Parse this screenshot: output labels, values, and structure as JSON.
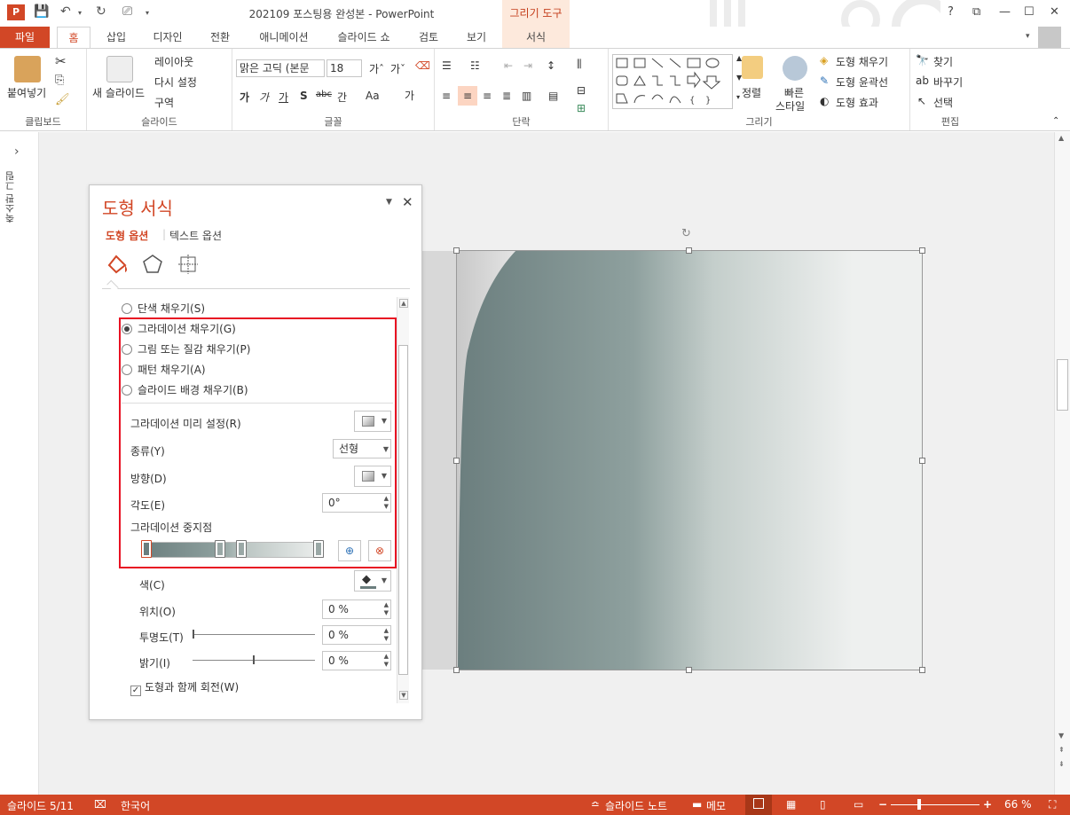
{
  "app": {
    "logo": "P",
    "doc_title": "202109 포스팅용 완성본 - PowerPoint",
    "context_group": "그리기 도구",
    "window_buttons": {
      "help": "?",
      "ribbon_options": "⧉",
      "minimize": "—",
      "maximize": "☐",
      "close": "✕"
    }
  },
  "tabs": [
    {
      "label": "파일"
    },
    {
      "label": "홈"
    },
    {
      "label": "삽입"
    },
    {
      "label": "디자인"
    },
    {
      "label": "전환"
    },
    {
      "label": "애니메이션"
    },
    {
      "label": "슬라이드 쇼"
    },
    {
      "label": "검토"
    },
    {
      "label": "보기"
    },
    {
      "label": "서식"
    }
  ],
  "ribbon": {
    "clipboard": {
      "paste": "붙여넣기",
      "group": "클립보드"
    },
    "slides": {
      "new_slide": "새 슬라이드",
      "layout": "레이아웃",
      "reset": "다시 설정",
      "section": "구역",
      "group": "슬라이드"
    },
    "font": {
      "name": "맑은 고딕 (본문",
      "size": "18",
      "group": "글꼴",
      "bold": "가",
      "italic": "가",
      "underline": "가",
      "shadow": "S",
      "strike": "abc",
      "spacing": "간",
      "case": "Aa",
      "color": "가"
    },
    "paragraph": {
      "group": "단락"
    },
    "drawing": {
      "arrange": "정렬",
      "quick_styles": "빠른",
      "quick_styles2": "스타일",
      "fill": "도형 채우기",
      "outline": "도형 윤곽선",
      "effects": "도형 효과",
      "group": "그리기"
    },
    "editing": {
      "find": "찾기",
      "replace": "바꾸기",
      "select": "선택",
      "group": "편집"
    }
  },
  "left_strip": {
    "label": "축소판 그림",
    "expand": "›"
  },
  "pane": {
    "title": "도형 서식",
    "tab_shape": "도형 옵션",
    "tab_text": "텍스트 옵션",
    "fill_options": [
      {
        "label": "단색 채우기(S)",
        "selected": false
      },
      {
        "label": "그라데이션 채우기(G)",
        "selected": true
      },
      {
        "label": "그림 또는 질감 채우기(P)",
        "selected": false
      },
      {
        "label": "패턴 채우기(A)",
        "selected": false
      },
      {
        "label": "슬라이드 배경 채우기(B)",
        "selected": false
      }
    ],
    "preset_label": "그라데이션 미리 설정(R)",
    "type_label": "종류(Y)",
    "type_value": "선형",
    "direction_label": "방향(D)",
    "angle_label": "각도(E)",
    "angle_value": "0°",
    "stops_label": "그라데이션 중지점",
    "stops": [
      0.0,
      0.43,
      0.55,
      1.0
    ],
    "color_label": "색(C)",
    "position_label": "위치(O)",
    "position_value": "0 %",
    "transparency_label": "투명도(T)",
    "transparency_value": "0 %",
    "brightness_label": "밝기(I)",
    "brightness_value": "0 %",
    "rotate_label": "도형과 함께 회전(W)",
    "rotate_checked": true
  },
  "status": {
    "slide": "슬라이드 5/11",
    "language": "한국어",
    "notes": "슬라이드 노트",
    "comments": "메모",
    "zoom": "66 %"
  },
  "colors": {
    "accent": "#d24726",
    "gradient_dark": "#6f8282",
    "gradient_light": "#eef0ef",
    "highlight_box": "#e81123"
  }
}
